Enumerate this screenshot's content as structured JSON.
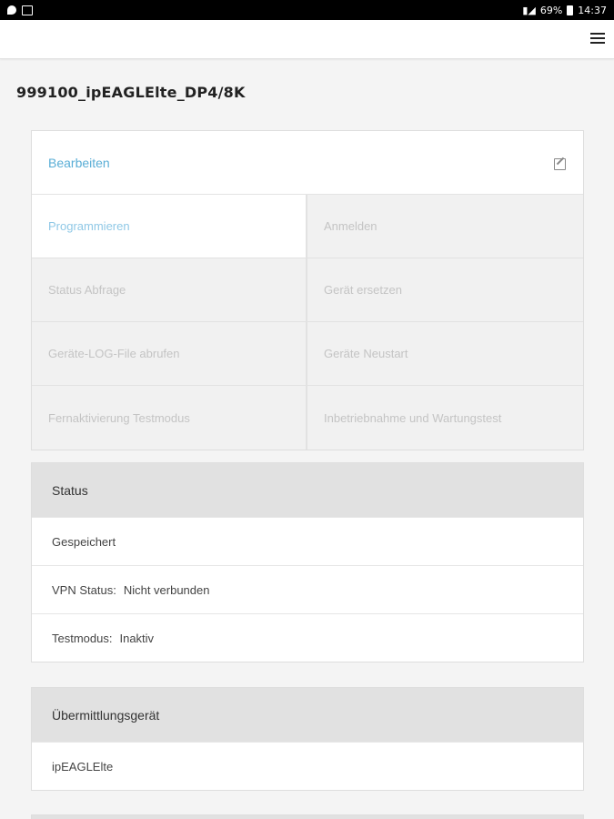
{
  "statusbar": {
    "battery": "69%",
    "time": "14:37"
  },
  "page": {
    "title": "999100_ipEAGLElte_DP4/8K"
  },
  "actions": {
    "edit_label": "Bearbeiten",
    "items": [
      {
        "label": "Programmieren",
        "active": true
      },
      {
        "label": "Anmelden",
        "active": false
      },
      {
        "label": "Status Abfrage",
        "active": false
      },
      {
        "label": "Gerät ersetzen",
        "active": false
      },
      {
        "label": "Geräte-LOG-File abrufen",
        "active": false
      },
      {
        "label": "Geräte Neustart",
        "active": false
      },
      {
        "label": "Fernaktivierung Testmodus",
        "active": false
      },
      {
        "label": "Inbetriebnahme und Wartungstest",
        "active": false
      }
    ]
  },
  "status": {
    "heading": "Status",
    "saved": "Gespeichert",
    "vpn_label": "VPN Status:",
    "vpn_value": "Nicht verbunden",
    "test_label": "Testmodus:",
    "test_value": "Inaktiv"
  },
  "device": {
    "heading": "Übermittlungsgerät",
    "value": "ipEAGLElte"
  },
  "colors": {
    "accent": "#5aaed6",
    "disabled_text": "#c4c4c4",
    "panel_header": "#e1e1e1"
  },
  "icons": [
    "hamburger-menu-icon",
    "edit-icon"
  ]
}
